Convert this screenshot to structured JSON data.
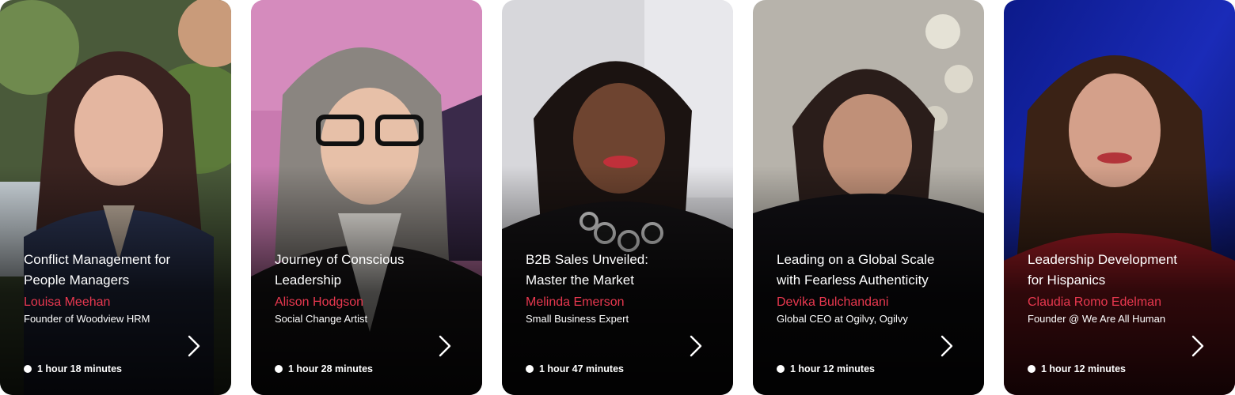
{
  "courses": [
    {
      "title": "Conflict Management for\nPeople Managers",
      "speaker": "Louisa Meehan",
      "role": "Founder of Woodview HRM",
      "duration": "1 hour 18 minutes",
      "icon": "chevron-right-icon"
    },
    {
      "title": "Journey of Conscious\nLeadership",
      "speaker": "Alison Hodgson",
      "role": "Social Change Artist",
      "duration": "1 hour 28 minutes",
      "icon": "chevron-right-icon"
    },
    {
      "title": "B2B Sales Unveiled:\nMaster the Market",
      "speaker": "Melinda Emerson",
      "role": "Small Business Expert",
      "duration": "1 hour 47 minutes",
      "icon": "chevron-right-icon"
    },
    {
      "title": "Leading on a Global Scale\nwith Fearless Authenticity",
      "speaker": "Devika Bulchandani",
      "role": "Global CEO at Ogilvy, Ogilvy",
      "duration": "1 hour 12 minutes",
      "icon": "chevron-right-icon"
    },
    {
      "title": "Leadership Development\nfor  Hispanics",
      "speaker": "Claudia Romo Edelman",
      "role": "Founder @ We Are All Human",
      "duration": "1 hour 12 minutes",
      "icon": "chevron-right-icon"
    }
  ],
  "colors": {
    "speaker_accent": "#e8384f",
    "text": "#ffffff"
  }
}
